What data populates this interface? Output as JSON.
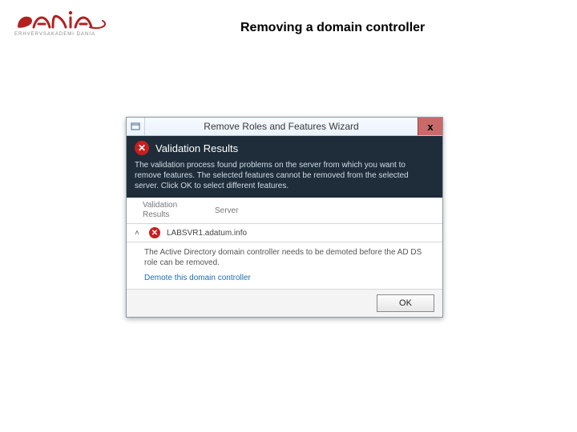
{
  "brand": {
    "subtext": "ERHVERVSAKADEMI DANIA"
  },
  "page": {
    "title": "Removing a domain controller"
  },
  "dialog": {
    "title": "Remove Roles and Features Wizard",
    "close_glyph": "x",
    "validation_title": "Validation Results",
    "validation_message": "The validation process found problems on the server from which you want to remove features. The selected features cannot be removed from the selected server. Click OK to select different features.",
    "columns": [
      "Validation Results",
      "Server"
    ],
    "server_row": {
      "chevron": "˄",
      "server": "LABSVR1.adatum.info"
    },
    "detail": "The Active Directory domain controller needs to be demoted before the AD DS role can be removed.",
    "demote_link": "Demote this domain controller",
    "ok_label": "OK"
  }
}
